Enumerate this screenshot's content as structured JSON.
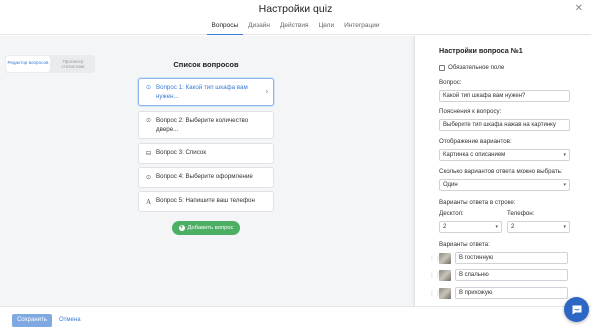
{
  "header": {
    "title": "Настройки quiz",
    "close_icon": "close-icon",
    "tabs": [
      {
        "label": "Вопросы",
        "active": true
      },
      {
        "label": "Дизайн",
        "active": false
      },
      {
        "label": "Действия",
        "active": false
      },
      {
        "label": "Цели",
        "active": false
      },
      {
        "label": "Интеграции",
        "active": false
      }
    ]
  },
  "editor_toggle": {
    "editor_label": "Редактор вопросов",
    "stats_label": "Просмотр статистики"
  },
  "question_list": {
    "title": "Список вопросов",
    "items": [
      {
        "icon": "radio-icon",
        "label": "Вопрос 1: Какой тип шкафа вам нужен...",
        "active": true
      },
      {
        "icon": "radio-icon",
        "label": "Вопрос 2: Выберите количество двере...",
        "active": false
      },
      {
        "icon": "list-icon",
        "label": "Вопрос 3: Список",
        "active": false
      },
      {
        "icon": "radio-icon",
        "label": "Вопрос 4: Выберите оформление",
        "active": false
      },
      {
        "icon": "text-icon",
        "label": "Вопрос 5: Напишите ваш телефон",
        "active": false
      }
    ],
    "add_label": "Добавить вопрос"
  },
  "settings": {
    "title": "Настройки вопроса №1",
    "required_label": "Обязательное поле",
    "question_label": "Вопрос:",
    "question_value": "Какой тип шкафа вам нужен?",
    "hint_label": "Пояснения к вопросу:",
    "hint_value": "Выберите тип шкафа нажав на картинку",
    "display_label": "Отображение вариантов:",
    "display_value": "Картинка с описанием",
    "count_label": "Сколько вариантов ответа можно выбрать:",
    "count_value": "Один",
    "per_row_label": "Варианты ответа в строке:",
    "desktop_label": "Десктоп:",
    "desktop_value": "2",
    "tablet_label": "Телефон:",
    "tablet_value": "2",
    "answers_label": "Варианты ответа:",
    "answers": [
      "В гостинную",
      "В спальню",
      "В прихожую"
    ]
  },
  "footer": {
    "save_label": "Сохранить",
    "cancel_label": "Отмена"
  },
  "colors": {
    "accent": "#3a7bd5",
    "add_button": "#4caf63",
    "chat_button": "#2d67c5"
  }
}
